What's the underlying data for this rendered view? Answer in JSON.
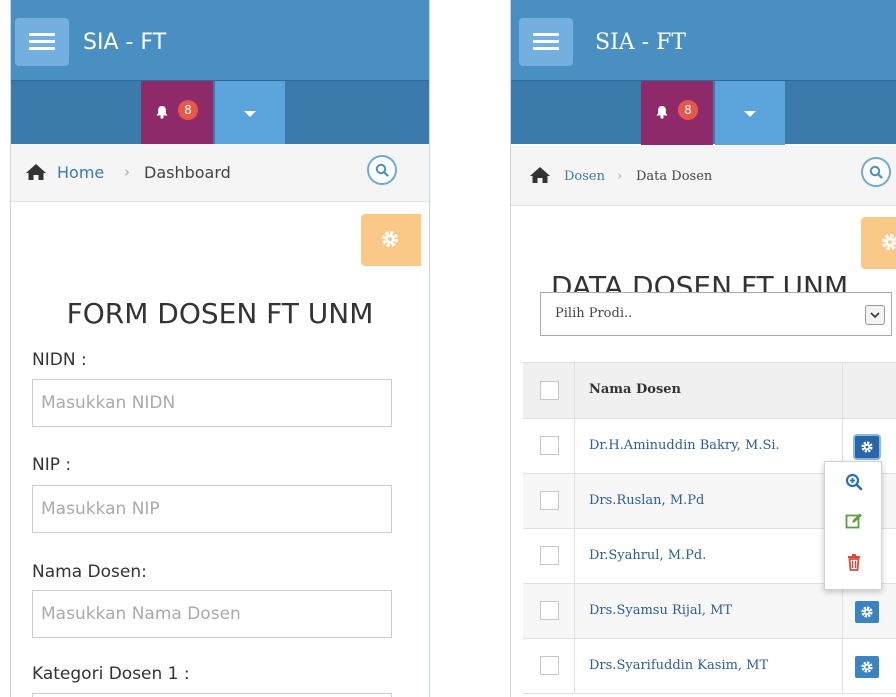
{
  "colors": {
    "navbar": "#4a8fc1",
    "navbar_dark": "#3a7bab",
    "notification_button": "#8e2a6a",
    "dropdown_button": "#5aa3db",
    "badge": "#e8584a",
    "settings_tab": "#fbc987",
    "link": "#2a5d9f",
    "action_button": "#3a84c4"
  },
  "left": {
    "app_title": "SIA - FT",
    "notification_count": "8",
    "breadcrumb": {
      "home": "Home",
      "separator": "›",
      "current": "Dashboard"
    },
    "form": {
      "title": "FORM DOSEN FT UNM",
      "nidn_label": "NIDN :",
      "nidn_placeholder": "Masukkan NIDN",
      "nip_label": "NIP :",
      "nip_placeholder": "Masukkan NIP",
      "nama_label": "Nama Dosen:",
      "nama_placeholder": "Masukkan Nama Dosen",
      "kategori_label": "Kategori Dosen 1 :"
    }
  },
  "right": {
    "app_title": "SIA - FT",
    "notification_count": "8",
    "breadcrumb": {
      "home": "Dosen",
      "separator": "›",
      "current": "Data Dosen"
    },
    "page_title": "DATA DOSEN FT UNM",
    "prodi_select": {
      "selected": "Pilih Prodi.."
    },
    "table": {
      "column_name": "Nama Dosen",
      "rows": [
        {
          "name": "Dr.H.Aminuddin Bakry, M.Si."
        },
        {
          "name": "Drs.Ruslan, M.Pd"
        },
        {
          "name": "Dr.Syahrul, M.Pd."
        },
        {
          "name": "Drs.Syamsu Rijal, MT"
        },
        {
          "name": "Drs.Syarifuddin Kasim, MT"
        }
      ]
    },
    "action_menu": {
      "items": [
        {
          "icon": "zoom-in-icon",
          "color": "#2a6fb5"
        },
        {
          "icon": "edit-icon",
          "color": "#5aa03a"
        },
        {
          "icon": "trash-icon",
          "color": "#d94a3a"
        }
      ]
    }
  }
}
